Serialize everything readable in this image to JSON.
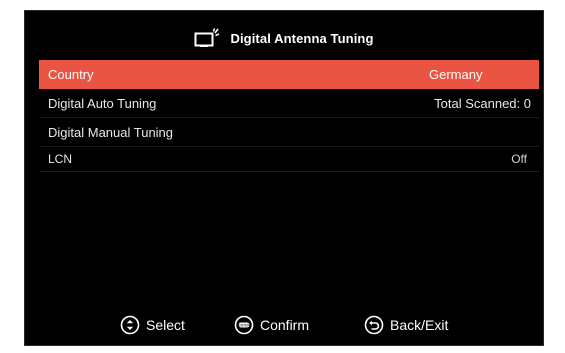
{
  "header": {
    "icon": "tv-antenna-icon",
    "title": "Digital Antenna Tuning"
  },
  "menu": {
    "items": [
      {
        "label": "Country",
        "value": "Germany",
        "selected": true
      },
      {
        "label": "Digital Auto Tuning",
        "value": "Total Scanned: 0",
        "selected": false
      },
      {
        "label": "Digital Manual Tuning",
        "value": "",
        "selected": false
      },
      {
        "label": "LCN",
        "value": "Off",
        "selected": false
      }
    ]
  },
  "footer": {
    "select": {
      "icon": "updown-circle-icon",
      "label": "Select"
    },
    "confirm": {
      "icon": "enter-circle-icon",
      "label": "Confirm",
      "icon_text": "ENTER"
    },
    "back": {
      "icon": "back-circle-icon",
      "label": "Back/Exit"
    }
  },
  "colors": {
    "screen_bg": "#000000",
    "highlight": "#ea5443",
    "text": "#e8e8e8"
  }
}
